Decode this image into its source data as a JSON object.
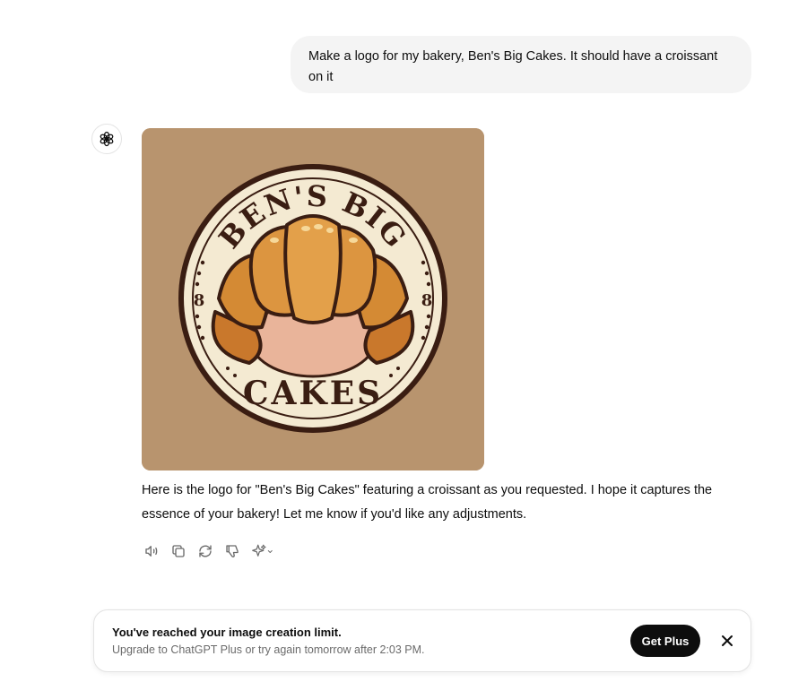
{
  "user_message": "Make a logo for my bakery, Ben's Big Cakes. It should have a croissant on it",
  "assistant": {
    "avatar_icon": "openai-logo-icon",
    "image": {
      "logo_text_top": "BEN'S BIG",
      "logo_text_bottom": "CAKES",
      "logo_side_mark": "8",
      "background_color": "#b8946e",
      "badge_color": "#f4ead2",
      "outline_color": "#3a1d12",
      "croissant_color": "#d48a34"
    },
    "reply": "Here is the logo for \"Ben's Big Cakes\" featuring a croissant as you requested. I hope it captures the essence of your bakery! Let me know if you'd like any adjustments.",
    "actions": [
      "read-aloud-icon",
      "copy-icon",
      "regenerate-icon",
      "thumbs-down-icon",
      "sparkle-model-icon"
    ]
  },
  "limit_banner": {
    "title": "You've reached your image creation limit.",
    "subtitle": "Upgrade to ChatGPT Plus or try again tomorrow after 2:03 PM.",
    "button_label": "Get Plus"
  }
}
